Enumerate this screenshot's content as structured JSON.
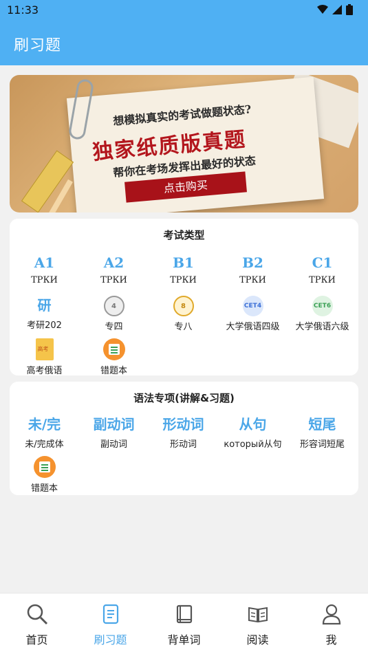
{
  "status": {
    "time": "11:33"
  },
  "header": {
    "title": "刷习题"
  },
  "banner": {
    "line1": "想模拟真实的考试做题状态?",
    "line2": "独家纸质版真题",
    "line3": "帮你在考场发挥出最好的状态",
    "button": "点击购买"
  },
  "exam_types": {
    "title": "考试类型",
    "levels": [
      {
        "code": "A1",
        "label": "ТРКИ"
      },
      {
        "code": "A2",
        "label": "ТРКИ"
      },
      {
        "code": "B1",
        "label": "ТРКИ"
      },
      {
        "code": "B2",
        "label": "ТРКИ"
      },
      {
        "code": "C1",
        "label": "ТРКИ"
      }
    ],
    "row2": [
      {
        "icon": "研",
        "label": "考研202"
      },
      {
        "icon": "4",
        "label": "专四"
      },
      {
        "icon": "8",
        "label": "专八"
      },
      {
        "icon": "CET4",
        "label": "大学俄语四级"
      },
      {
        "icon": "CET6",
        "label": "大学俄语六级"
      }
    ],
    "row3": [
      {
        "label": "高考俄语"
      },
      {
        "label": "错题本"
      }
    ]
  },
  "grammar": {
    "title": "语法专项(讲解&习题)",
    "items": [
      {
        "name": "未/完",
        "label": "未/完成体"
      },
      {
        "name": "副动词",
        "label": "副动词"
      },
      {
        "name": "形动词",
        "label": "形动词"
      },
      {
        "name": "从句",
        "label": "который从句"
      },
      {
        "name": "短尾",
        "label": "形容词短尾"
      }
    ],
    "extra": {
      "label": "错题本"
    }
  },
  "nav": {
    "items": [
      {
        "label": "首页"
      },
      {
        "label": "刷习题"
      },
      {
        "label": "背单词"
      },
      {
        "label": "阅读"
      },
      {
        "label": "我"
      }
    ]
  },
  "colors": {
    "primary": "#4fb0f3",
    "accent": "#4aa6e8",
    "banner_red": "#a81219"
  }
}
